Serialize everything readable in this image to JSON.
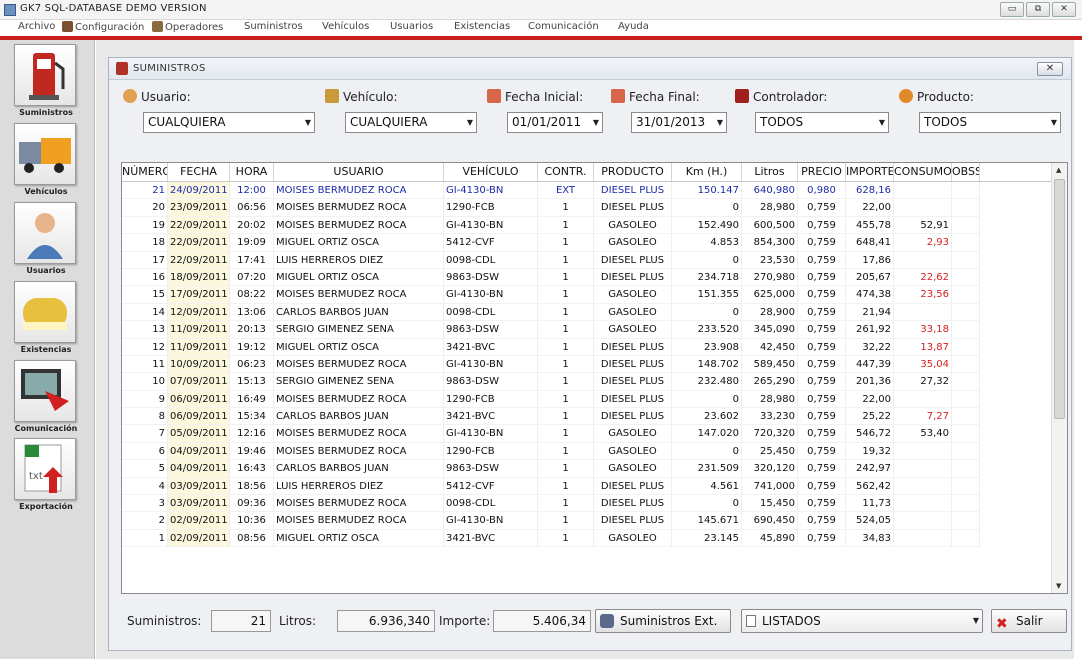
{
  "window": {
    "title": "GK7 SQL-DATABASE DEMO VERSION",
    "minimize": "▭",
    "restore": "⧉",
    "close": "✕"
  },
  "menu": [
    {
      "label": "Archivo",
      "icon": ""
    },
    {
      "label": "Configuración",
      "icon": "wrench-icon"
    },
    {
      "label": "Operadores",
      "icon": "operator-icon"
    },
    {
      "label": "Suministros",
      "icon": ""
    },
    {
      "label": "Vehículos",
      "icon": ""
    },
    {
      "label": "Usuarios",
      "icon": ""
    },
    {
      "label": "Existencias",
      "icon": ""
    },
    {
      "label": "Comunicación",
      "icon": ""
    },
    {
      "label": "Ayuda",
      "icon": ""
    }
  ],
  "sidebar": [
    {
      "label": "Suministros",
      "icon": "fuel-pump-icon"
    },
    {
      "label": "Vehículos",
      "icon": "truck-icon"
    },
    {
      "label": "Usuarios",
      "icon": "user-icon"
    },
    {
      "label": "Existencias",
      "icon": "tank-icon"
    },
    {
      "label": "Comunicación",
      "icon": "monitor-icon"
    },
    {
      "label": "Exportación",
      "icon": "excel-export-icon"
    }
  ],
  "panel": {
    "title": "SUMINISTROS",
    "close": "✕"
  },
  "filters": {
    "usuario": {
      "label": "Usuario:",
      "value": "CUALQUIERA"
    },
    "vehiculo": {
      "label": "Vehículo:",
      "value": "CUALQUIERA"
    },
    "fecha_inicial": {
      "label": "Fecha Inicial:",
      "value": "01/01/2011"
    },
    "fecha_final": {
      "label": "Fecha Final:",
      "value": "31/01/2013"
    },
    "controlador": {
      "label": "Controlador:",
      "value": "TODOS"
    },
    "producto": {
      "label": "Producto:",
      "value": "TODOS"
    }
  },
  "table": {
    "columns": [
      "NÚMERO",
      "FECHA",
      "HORA",
      "USUARIO",
      "VEHÍCULO",
      "CONTR.",
      "PRODUCTO",
      "Km (H.)",
      "Litros",
      "PRECIO",
      "IMPORTE",
      "CONSUMO",
      "OBSS"
    ],
    "rows": [
      [
        "21",
        "24/09/2011",
        "12:00",
        "MOISES BERMUDEZ ROCA",
        "GI-4130-BN",
        "EXT",
        "DIESEL PLUS",
        "150.147",
        "640,980",
        "0,980",
        "628,16",
        "",
        ""
      ],
      [
        "20",
        "23/09/2011",
        "06:56",
        "MOISES BERMUDEZ ROCA",
        "1290-FCB",
        "1",
        "DIESEL PLUS",
        "0",
        "28,980",
        "0,759",
        "22,00",
        "",
        ""
      ],
      [
        "19",
        "22/09/2011",
        "20:02",
        "MOISES BERMUDEZ ROCA",
        "GI-4130-BN",
        "1",
        "GASOLEO",
        "152.490",
        "600,500",
        "0,759",
        "455,78",
        "52,91",
        ""
      ],
      [
        "18",
        "22/09/2011",
        "19:09",
        "MIGUEL ORTIZ OSCA",
        "5412-CVF",
        "1",
        "GASOLEO",
        "4.853",
        "854,300",
        "0,759",
        "648,41",
        "2,93",
        ""
      ],
      [
        "17",
        "22/09/2011",
        "17:41",
        "LUIS HERREROS DIEZ",
        "0098-CDL",
        "1",
        "DIESEL PLUS",
        "0",
        "23,530",
        "0,759",
        "17,86",
        "",
        ""
      ],
      [
        "16",
        "18/09/2011",
        "07:20",
        "MIGUEL ORTIZ OSCA",
        "9863-DSW",
        "1",
        "DIESEL PLUS",
        "234.718",
        "270,980",
        "0,759",
        "205,67",
        "22,62",
        ""
      ],
      [
        "15",
        "17/09/2011",
        "08:22",
        "MOISES BERMUDEZ ROCA",
        "GI-4130-BN",
        "1",
        "GASOLEO",
        "151.355",
        "625,000",
        "0,759",
        "474,38",
        "23,56",
        ""
      ],
      [
        "14",
        "12/09/2011",
        "13:06",
        "CARLOS BARBOS JUAN",
        "0098-CDL",
        "1",
        "GASOLEO",
        "0",
        "28,900",
        "0,759",
        "21,94",
        "",
        ""
      ],
      [
        "13",
        "11/09/2011",
        "20:13",
        "SERGIO GIMENEZ SENA",
        "9863-DSW",
        "1",
        "GASOLEO",
        "233.520",
        "345,090",
        "0,759",
        "261,92",
        "33,18",
        ""
      ],
      [
        "12",
        "11/09/2011",
        "19:12",
        "MIGUEL ORTIZ OSCA",
        "3421-BVC",
        "1",
        "DIESEL PLUS",
        "23.908",
        "42,450",
        "0,759",
        "32,22",
        "13,87",
        ""
      ],
      [
        "11",
        "10/09/2011",
        "06:23",
        "MOISES BERMUDEZ ROCA",
        "GI-4130-BN",
        "1",
        "DIESEL PLUS",
        "148.702",
        "589,450",
        "0,759",
        "447,39",
        "35,04",
        ""
      ],
      [
        "10",
        "07/09/2011",
        "15:13",
        "SERGIO GIMENEZ SENA",
        "9863-DSW",
        "1",
        "DIESEL PLUS",
        "232.480",
        "265,290",
        "0,759",
        "201,36",
        "27,32",
        ""
      ],
      [
        "9",
        "06/09/2011",
        "16:49",
        "MOISES BERMUDEZ ROCA",
        "1290-FCB",
        "1",
        "DIESEL PLUS",
        "0",
        "28,980",
        "0,759",
        "22,00",
        "",
        ""
      ],
      [
        "8",
        "06/09/2011",
        "15:34",
        "CARLOS BARBOS JUAN",
        "3421-BVC",
        "1",
        "DIESEL PLUS",
        "23.602",
        "33,230",
        "0,759",
        "25,22",
        "7,27",
        ""
      ],
      [
        "7",
        "05/09/2011",
        "12:16",
        "MOISES BERMUDEZ ROCA",
        "GI-4130-BN",
        "1",
        "GASOLEO",
        "147.020",
        "720,320",
        "0,759",
        "546,72",
        "53,40",
        ""
      ],
      [
        "6",
        "04/09/2011",
        "19:46",
        "MOISES BERMUDEZ ROCA",
        "1290-FCB",
        "1",
        "GASOLEO",
        "0",
        "25,450",
        "0,759",
        "19,32",
        "",
        ""
      ],
      [
        "5",
        "04/09/2011",
        "16:43",
        "CARLOS BARBOS JUAN",
        "9863-DSW",
        "1",
        "GASOLEO",
        "231.509",
        "320,120",
        "0,759",
        "242,97",
        "",
        ""
      ],
      [
        "4",
        "03/09/2011",
        "18:56",
        "LUIS HERREROS DIEZ",
        "5412-CVF",
        "1",
        "DIESEL PLUS",
        "4.561",
        "741,000",
        "0,759",
        "562,42",
        "",
        ""
      ],
      [
        "3",
        "03/09/2011",
        "09:36",
        "MOISES BERMUDEZ ROCA",
        "0098-CDL",
        "1",
        "DIESEL PLUS",
        "0",
        "15,450",
        "0,759",
        "11,73",
        "",
        ""
      ],
      [
        "2",
        "02/09/2011",
        "10:36",
        "MOISES BERMUDEZ ROCA",
        "GI-4130-BN",
        "1",
        "DIESEL PLUS",
        "145.671",
        "690,450",
        "0,759",
        "524,05",
        "",
        ""
      ],
      [
        "1",
        "02/09/2011",
        "08:56",
        "MIGUEL ORTIZ OSCA",
        "3421-BVC",
        "1",
        "GASOLEO",
        "23.145",
        "45,890",
        "0,759",
        "34,83",
        "",
        ""
      ]
    ],
    "red_consumo_rows": [
      3,
      5,
      6,
      8,
      9,
      10,
      13
    ]
  },
  "footer": {
    "suministros_label": "Suministros:",
    "suministros_value": "21",
    "litros_label": "Litros:",
    "litros_value": "6.936,340",
    "importe_label": "Importe:",
    "importe_value": "5.406,34",
    "ext_button": "Suministros Ext.",
    "listados": "LISTADOS",
    "salir": "Salir"
  }
}
